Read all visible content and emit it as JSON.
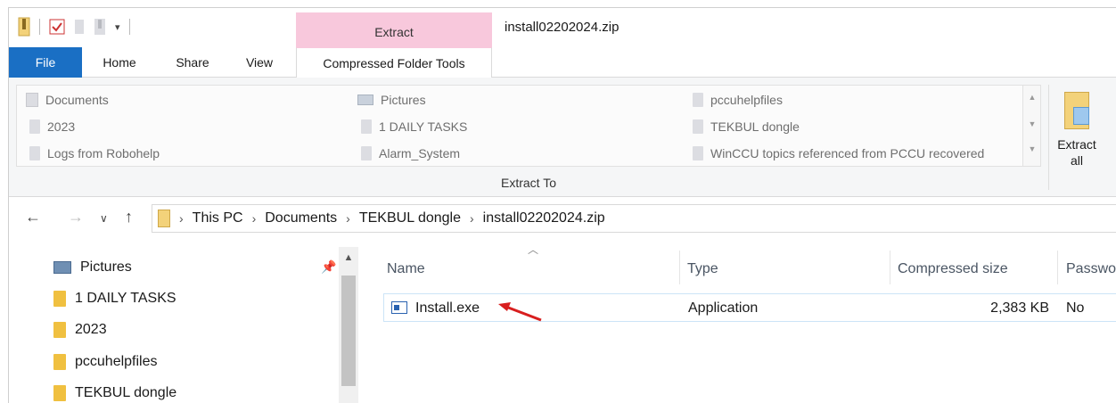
{
  "window": {
    "title": "install02202024.zip",
    "context_tab": "Extract"
  },
  "ribbon_tabs": {
    "file": "File",
    "home": "Home",
    "share": "Share",
    "view": "View",
    "compressed_folder_tools": "Compressed Folder Tools"
  },
  "extract_to": {
    "group_label": "Extract To",
    "items": [
      {
        "label": "Documents",
        "icon": "document-folder-icon"
      },
      {
        "label": "2023",
        "icon": "folder-icon"
      },
      {
        "label": "Logs from Robohelp",
        "icon": "folder-icon"
      },
      {
        "label": "Pictures",
        "icon": "pictures-folder-icon"
      },
      {
        "label": "1 DAILY TASKS",
        "icon": "folder-icon"
      },
      {
        "label": "Alarm_System",
        "icon": "folder-icon"
      },
      {
        "label": "pccuhelpfiles",
        "icon": "folder-icon"
      },
      {
        "label": "TEKBUL dongle",
        "icon": "folder-icon"
      },
      {
        "label": "WinCCU topics referenced from PCCU recovered",
        "icon": "folder-icon"
      }
    ],
    "extract_all_line1": "Extract",
    "extract_all_line2": "all"
  },
  "address": {
    "crumbs": [
      "This PC",
      "Documents",
      "TEKBUL dongle",
      "install02202024.zip"
    ]
  },
  "nav_pane": {
    "items": [
      {
        "label": "Pictures",
        "icon": "pictures-icon"
      },
      {
        "label": "1 DAILY TASKS",
        "icon": "folder-icon"
      },
      {
        "label": "2023",
        "icon": "folder-icon"
      },
      {
        "label": "pccuhelpfiles",
        "icon": "folder-icon"
      },
      {
        "label": "TEKBUL dongle",
        "icon": "folder-icon"
      }
    ]
  },
  "file_list": {
    "columns": [
      "Name",
      "Type",
      "Compressed size",
      "Passwo"
    ],
    "rows": [
      {
        "name": "Install.exe",
        "type": "Application",
        "size": "2,383 KB",
        "password": "No"
      }
    ]
  },
  "colors": {
    "file_tab": "#1a6fc4",
    "context_tab": "#f8c8dc",
    "arrow": "#d81e1e"
  }
}
